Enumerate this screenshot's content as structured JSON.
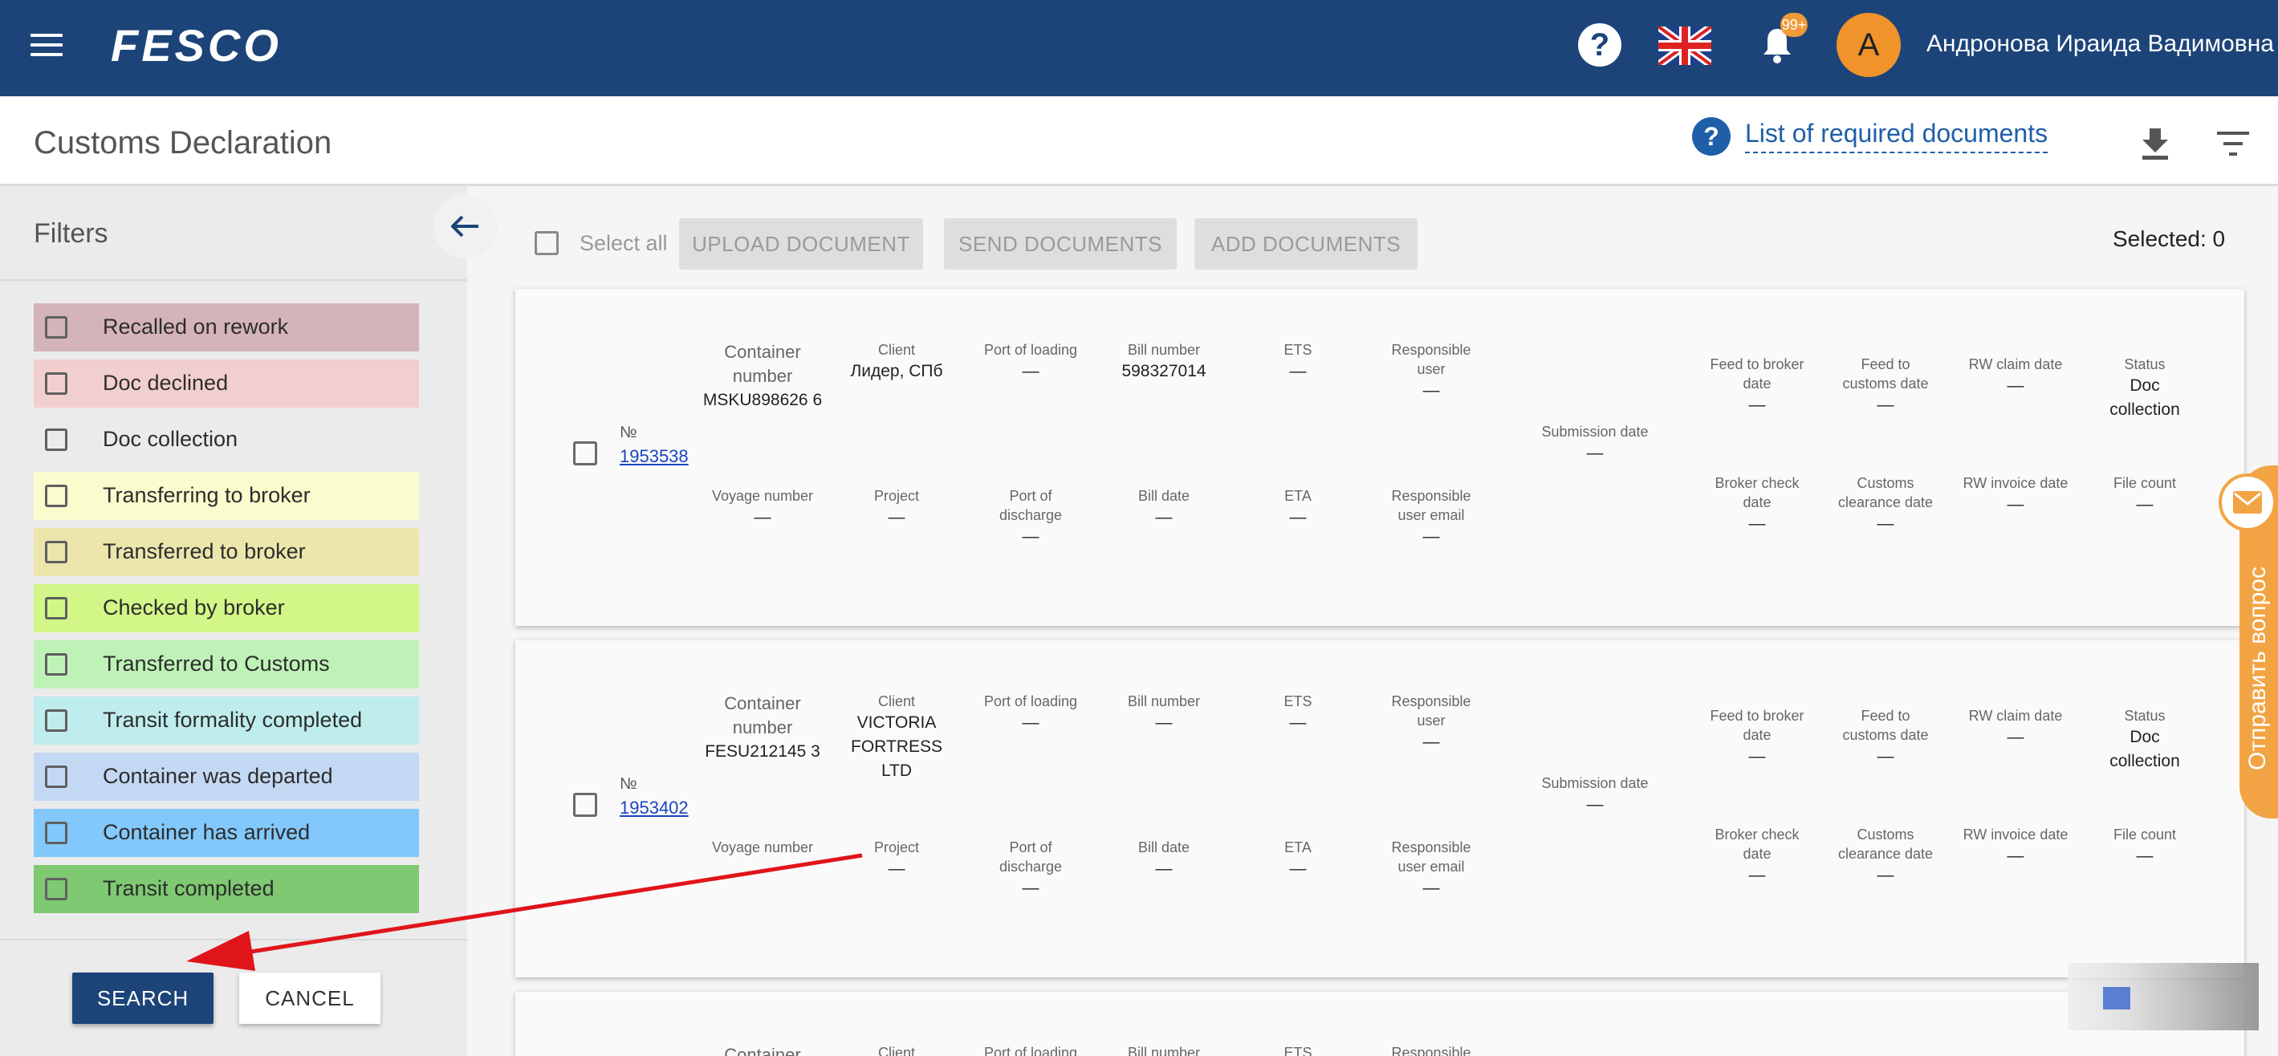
{
  "header": {
    "logo_text": "FESCO",
    "help_icon": "question-icon",
    "language_icon": "uk-flag-icon",
    "notification_icon": "bell-icon",
    "notification_badge": "99+",
    "avatar_letter": "A",
    "user_name": "Андронова Ираида Вадимовна",
    "brand_color": "#1c4479"
  },
  "titlebar": {
    "page_title": "Customs Declaration",
    "required_docs_link": "List of required documents",
    "download_icon": "download-icon",
    "filter_icon": "filter-icon"
  },
  "filters": {
    "title": "Filters",
    "collapse_icon": "arrow-left-icon",
    "statuses": [
      {
        "label": "Recalled on rework",
        "color": "#d4b4b8"
      },
      {
        "label": "Doc declined",
        "color": "#f2cfcf"
      },
      {
        "label": "Doc collection",
        "color": "#ebebeb"
      },
      {
        "label": "Transferring to broker",
        "color": "#fafccd"
      },
      {
        "label": "Transferred to broker",
        "color": "#ece6ad"
      },
      {
        "label": "Checked by broker",
        "color": "#d2f688"
      },
      {
        "label": "Transferred to Customs",
        "color": "#bff2b7"
      },
      {
        "label": "Transit formality completed",
        "color": "#bfeded"
      },
      {
        "label": "Container was departed",
        "color": "#c3d8f3"
      },
      {
        "label": "Container has arrived",
        "color": "#82c8fa"
      },
      {
        "label": "Transit completed",
        "color": "#7ec972"
      }
    ],
    "search_label": "SEARCH",
    "cancel_label": "CANCEL"
  },
  "toolbar": {
    "select_all_label": "Select all",
    "upload_label": "UPLOAD DOCUMENT",
    "send_label": "SEND DOCUMENTS",
    "add_label": "ADD DOCUMENTS",
    "selected_label": "Selected: 0"
  },
  "labels": {
    "num_prefix": "№",
    "container_number": "Container number",
    "client": "Client",
    "port_loading": "Port of loading",
    "bill_number": "Bill number",
    "ets": "ETS",
    "responsible_user": "Responsible user",
    "submission_date": "Submission date",
    "feed_broker": "Feed to broker date",
    "feed_customs": "Feed to customs date",
    "rw_claim": "RW claim date",
    "status": "Status",
    "voyage_number": "Voyage number",
    "project": "Project",
    "port_discharge": "Port of discharge",
    "bill_date": "Bill date",
    "eta": "ETA",
    "responsible_email": "Responsible user email",
    "broker_check": "Broker check date",
    "customs_clearance": "Customs clearance date",
    "rw_invoice": "RW invoice date",
    "file_count": "File count"
  },
  "cards": [
    {
      "number": "1953538",
      "container": "MSKU898626 6",
      "client": "Лидер, СПб",
      "port_loading": "—",
      "bill_number": "598327014",
      "ets": "—",
      "responsible_user": "—",
      "submission_date": "—",
      "feed_broker": "—",
      "feed_customs": "—",
      "rw_claim": "—",
      "status": "Doc collection",
      "voyage_number": "—",
      "project": "—",
      "port_discharge": "—",
      "bill_date": "—",
      "eta": "—",
      "responsible_email": "—",
      "broker_check": "—",
      "customs_clearance": "—",
      "rw_invoice": "—",
      "file_count": "—"
    },
    {
      "number": "1953402",
      "container": "FESU212145 3",
      "client": "VICTORIA FORTRESS LTD",
      "port_loading": "—",
      "bill_number": "—",
      "ets": "—",
      "responsible_user": "—",
      "submission_date": "—",
      "feed_broker": "—",
      "feed_customs": "—",
      "rw_claim": "—",
      "status": "Doc collection",
      "voyage_number": "",
      "project": "—",
      "port_discharge": "—",
      "bill_date": "—",
      "eta": "—",
      "responsible_email": "—",
      "broker_check": "—",
      "customs_clearance": "—",
      "rw_invoice": "—",
      "file_count": "—"
    }
  ],
  "side_tab": {
    "label": "Отправить вопрос",
    "icon": "mail-icon"
  }
}
